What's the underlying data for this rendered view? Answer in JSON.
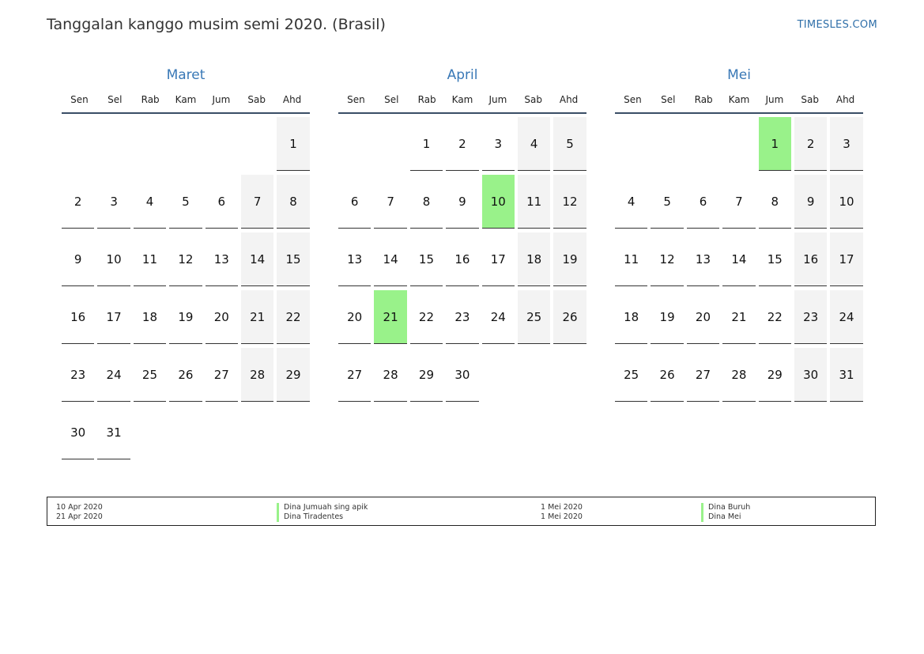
{
  "header": {
    "title": "Tanggalan kanggo musim semi 2020. (Brasil)",
    "brand": "TIMESLES.COM"
  },
  "weekdays": [
    "Sen",
    "Sel",
    "Rab",
    "Kam",
    "Jum",
    "Sab",
    "Ahd"
  ],
  "colors": {
    "month_title": "#3978b6",
    "holiday": "#99f28a",
    "weekend": "#f3f3f3",
    "brand": "#2f6fa9"
  },
  "months": [
    {
      "name": "Maret",
      "first_weekday": 6,
      "days": 31,
      "holidays": []
    },
    {
      "name": "April",
      "first_weekday": 2,
      "days": 30,
      "holidays": [
        10,
        21
      ]
    },
    {
      "name": "Mei",
      "first_weekday": 4,
      "days": 31,
      "holidays": [
        1
      ]
    }
  ],
  "legend": {
    "left_dates": [
      "10 Apr 2020",
      "21 Apr 2020"
    ],
    "left_names": [
      "Dina Jumuah sing apik",
      "Dina Tiradentes"
    ],
    "right_dates": [
      "1 Mei 2020",
      "1 Mei 2020"
    ],
    "right_names": [
      "Dina Buruh",
      "Dina Mei"
    ]
  }
}
